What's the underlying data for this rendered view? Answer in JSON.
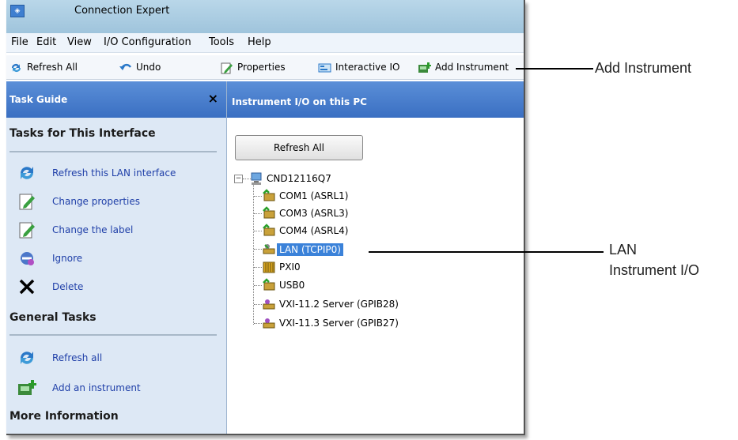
{
  "window": {
    "title": "Connection Expert",
    "app_icon": "connection-expert-icon"
  },
  "menu": {
    "items": [
      "File",
      "Edit",
      "View",
      "I/O Configuration",
      "Tools",
      "Help"
    ]
  },
  "toolbar": {
    "refresh_all": "Refresh All",
    "undo": "Undo",
    "properties": "Properties",
    "interactive_io": "Interactive IO",
    "add_instrument": "Add Instrument"
  },
  "task_guide": {
    "header": "Task Guide",
    "close": "×",
    "interface_section": "Tasks for This Interface",
    "interface_tasks": [
      {
        "label": "Refresh this LAN interface",
        "icon": "refresh-icon"
      },
      {
        "label": "Change properties",
        "icon": "properties-icon"
      },
      {
        "label": "Change the label",
        "icon": "label-icon"
      },
      {
        "label": "Ignore",
        "icon": "ignore-icon"
      },
      {
        "label": "Delete",
        "icon": "delete-icon"
      }
    ],
    "general_section": "General Tasks",
    "general_tasks": [
      {
        "label": "Refresh all",
        "icon": "refresh-icon"
      },
      {
        "label": "Add an instrument",
        "icon": "add-instrument-icon"
      }
    ],
    "more_section": "More Information"
  },
  "main": {
    "header": "Instrument I/O on this PC",
    "refresh_button": "Refresh All",
    "tree": {
      "root": "CND12116Q7",
      "children": [
        "COM1 (ASRL1)",
        "COM3 (ASRL3)",
        "COM4 (ASRL4)",
        "LAN (TCPIP0)",
        "PXI0",
        "USB0",
        "VXI-11.2 Server (GPIB28)",
        "VXI-11.3 Server (GPIB27)"
      ],
      "selected": "LAN (TCPIP0)"
    }
  },
  "callouts": {
    "add_instrument": "Add Instrument",
    "lan_line1": "LAN",
    "lan_line2": "Instrument I/O"
  },
  "colors": {
    "header_blue": "#3a6fc2",
    "selection": "#3b82d9",
    "link": "#1f3fa8"
  }
}
